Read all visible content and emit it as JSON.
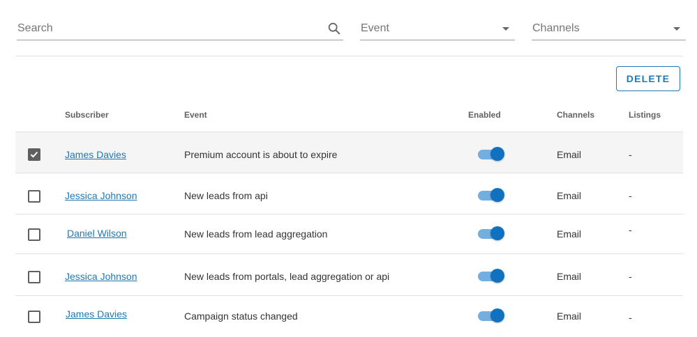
{
  "filters": {
    "search_placeholder": "Search",
    "event_placeholder": "Event",
    "channels_placeholder": "Channels"
  },
  "toolbar": {
    "delete_label": "DELETE"
  },
  "table": {
    "columns": {
      "subscriber": "Subscriber",
      "event": "Event",
      "enabled": "Enabled",
      "channels": "Channels",
      "listings": "Listings"
    },
    "rows": [
      {
        "subscriber": "James Davies",
        "event": "Premium account is about to expire",
        "enabled": true,
        "channels": "Email",
        "listings": "-",
        "checked": true
      },
      {
        "subscriber": "Jessica Johnson",
        "event": "New leads from api",
        "enabled": true,
        "channels": "Email",
        "listings": "-",
        "checked": false
      },
      {
        "subscriber": "Daniel Wilson",
        "event": "New leads from lead aggregation",
        "enabled": true,
        "channels": "Email",
        "listings": "-",
        "checked": false
      },
      {
        "subscriber": "Jessica Johnson",
        "event": "New leads from portals, lead aggregation or api",
        "enabled": true,
        "channels": "Email",
        "listings": "-",
        "checked": false
      },
      {
        "subscriber": "James Davies",
        "event": "Campaign status changed",
        "enabled": true,
        "channels": "Email",
        "listings": "-",
        "checked": false
      }
    ]
  },
  "colors": {
    "accent": "#1f78b4",
    "toggle_thumb": "#1071c1",
    "toggle_track": "#73aee0",
    "checkbox": "#5f5f5f"
  }
}
